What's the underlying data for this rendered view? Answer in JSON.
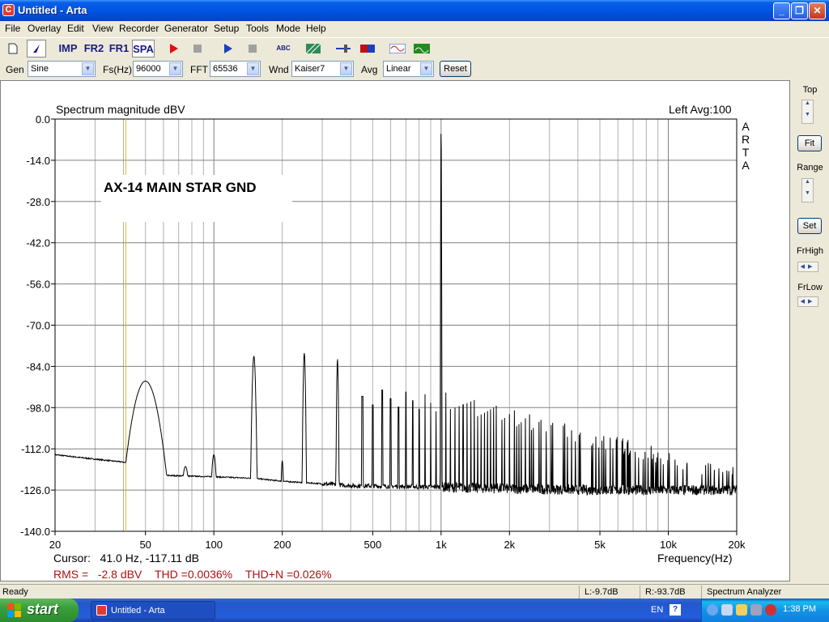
{
  "window": {
    "title": "Untitled - Arta",
    "app_icon_letter": "C"
  },
  "menu": [
    "File",
    "Overlay",
    "Edit",
    "View",
    "Recorder",
    "Generator",
    "Setup",
    "Tools",
    "Mode",
    "Help"
  ],
  "toolbar": {
    "imp": "IMP",
    "fr2": "FR2",
    "fr1": "FR1",
    "spa": "SPA",
    "abc": "ABC"
  },
  "settings": {
    "gen_label": "Gen",
    "gen_value": "Sine",
    "fs_label": "Fs(Hz)",
    "fs_value": "96000",
    "fft_label": "FFT",
    "fft_value": "65536",
    "wnd_label": "Wnd",
    "wnd_value": "Kaiser7",
    "avg_label": "Avg",
    "avg_value": "Linear",
    "reset_label": "Reset"
  },
  "right_panel": {
    "top": "Top",
    "fit": "Fit",
    "range": "Range",
    "set": "Set",
    "frhigh": "FrHigh",
    "frlow": "FrLow"
  },
  "chart_data": {
    "type": "line",
    "title": "Spectrum magnitude dBV",
    "channel_info": "Left  Avg:100",
    "side_label": "ARTA",
    "annotation": "AX-14 MAIN STAR GND",
    "xlabel": "Frequency(Hz)",
    "x_scale": "log",
    "xlim": [
      20,
      20000
    ],
    "ylim": [
      -140,
      0
    ],
    "y_ticks": [
      "0.0",
      "-14.0",
      "-28.0",
      "-42.0",
      "-56.0",
      "-70.0",
      "-84.0",
      "-98.0",
      "-112.0",
      "-126.0",
      "-140.0"
    ],
    "x_ticks": [
      {
        "f": 20,
        "label": "20"
      },
      {
        "f": 50,
        "label": "50"
      },
      {
        "f": 100,
        "label": "100"
      },
      {
        "f": 200,
        "label": "200"
      },
      {
        "f": 500,
        "label": "500"
      },
      {
        "f": 1000,
        "label": "1k"
      },
      {
        "f": 2000,
        "label": "2k"
      },
      {
        "f": 5000,
        "label": "5k"
      },
      {
        "f": 10000,
        "label": "10k"
      },
      {
        "f": 20000,
        "label": "20k"
      }
    ],
    "grid": true,
    "cursor_freq": 41.0,
    "noise_floor": [
      [
        20,
        -114
      ],
      [
        30,
        -115.5
      ],
      [
        40,
        -116.5
      ],
      [
        60,
        -121
      ],
      [
        100,
        -121.5
      ],
      [
        150,
        -122
      ],
      [
        200,
        -123
      ],
      [
        400,
        -124.5
      ],
      [
        1000,
        -125
      ],
      [
        2000,
        -125.5
      ],
      [
        5000,
        -126
      ],
      [
        10000,
        -126
      ],
      [
        20000,
        -126
      ]
    ],
    "peaks": [
      {
        "f": 50,
        "db": -89,
        "w": 0.09
      },
      {
        "f": 75,
        "db": -118,
        "w": 0.03
      },
      {
        "f": 100,
        "db": -114,
        "w": 0.02
      },
      {
        "f": 150,
        "db": -80.5,
        "w": 0.012
      },
      {
        "f": 200,
        "db": -116,
        "w": 0.01
      },
      {
        "f": 250,
        "db": -79.5,
        "w": 0.008
      },
      {
        "f": 350,
        "db": -81.5,
        "w": 0.006
      },
      {
        "f": 1000,
        "db": -2,
        "w": 0.002
      }
    ],
    "cursor_readout": "Cursor:   41.0 Hz, -117.11 dB",
    "rms": "RMS =   -2.8 dBV",
    "thd": "THD =0.0036%",
    "thdn": "THD+N =0.026%"
  },
  "status": {
    "ready": "Ready",
    "left": "L:-9.7dB",
    "right": "R:-93.7dB",
    "mode": "Spectrum Analyzer"
  },
  "taskbar": {
    "start": "start",
    "task": "Untitled - Arta",
    "lang": "EN",
    "clock": "1:38 PM"
  }
}
